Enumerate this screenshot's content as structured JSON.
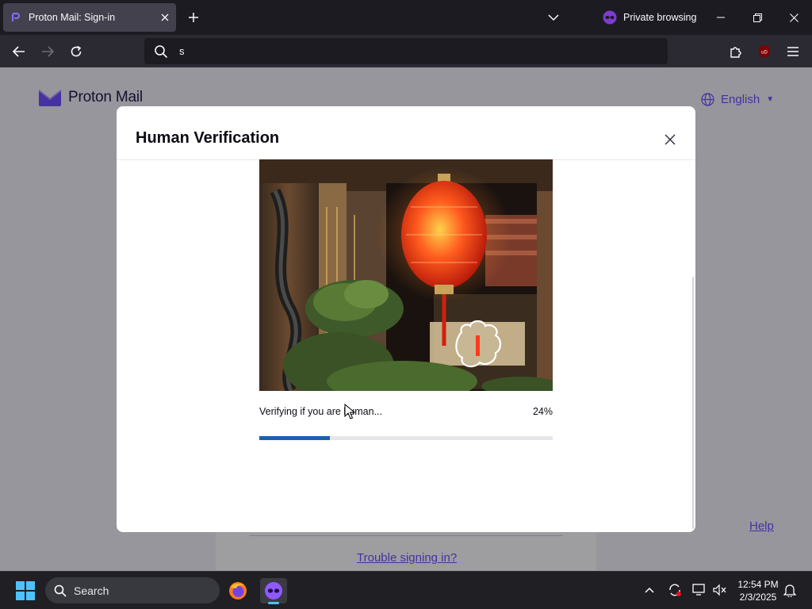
{
  "browser": {
    "tab_title": "Proton Mail: Sign-in",
    "private_label": "Private browsing",
    "url_value": "s"
  },
  "page": {
    "brand": "Proton Mail",
    "language": "English",
    "help_link": "Help",
    "trouble_link": "Trouble signing in?"
  },
  "modal": {
    "title": "Human Verification",
    "status_text": "Verifying if you are human...",
    "progress_label": "24%",
    "progress_fraction": 0.24
  },
  "taskbar": {
    "search_label": "Search",
    "time": "12:54 PM",
    "date": "2/3/2025"
  },
  "colors": {
    "brand": "#6d4aff",
    "progress": "#1a5fb4",
    "lantern": "#ff3c1e"
  },
  "icons": {
    "tab_close": "close-icon",
    "new_tab": "plus-icon",
    "private": "private-mask-icon",
    "back": "arrow-left-icon",
    "forward": "arrow-right-icon",
    "reload": "reload-icon",
    "search": "search-icon",
    "extensions": "puzzle-icon",
    "ublock": "ublock-origin-icon",
    "menu": "hamburger-menu-icon",
    "language": "globe-icon",
    "modal_close": "close-icon"
  }
}
